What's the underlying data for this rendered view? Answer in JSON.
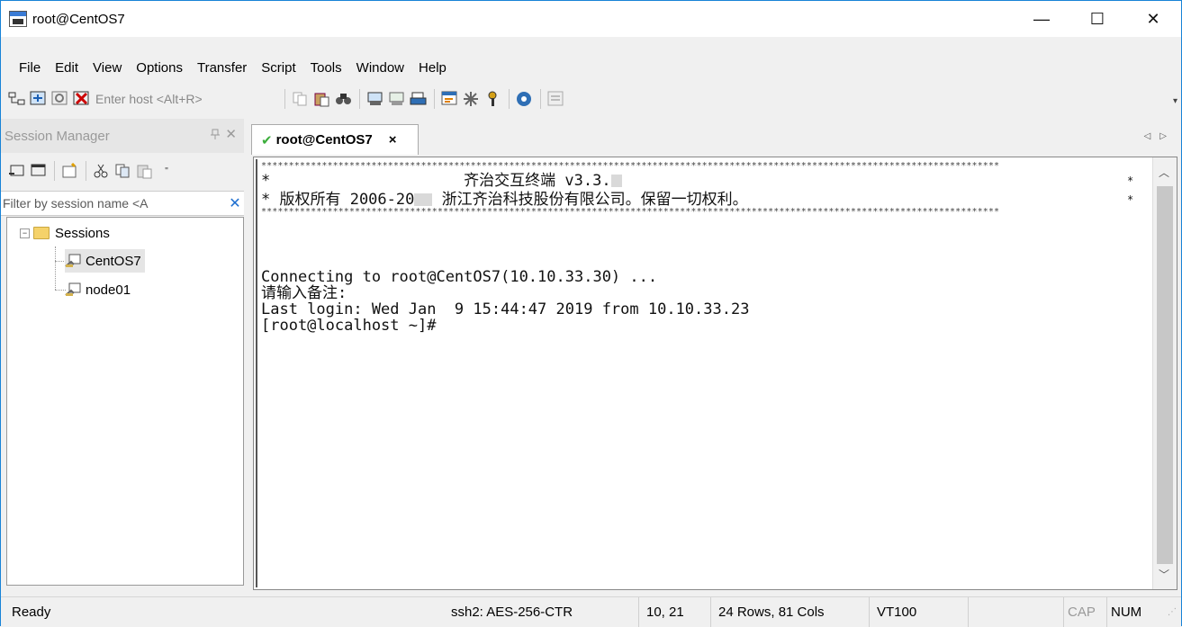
{
  "window": {
    "title": "root@CentOS7",
    "minimize": "—",
    "maximize": "☐",
    "close": "✕"
  },
  "menu": [
    "File",
    "Edit",
    "View",
    "Options",
    "Transfer",
    "Script",
    "Tools",
    "Window",
    "Help"
  ],
  "toolbar": {
    "host_placeholder": "Enter host <Alt+R>"
  },
  "session_manager": {
    "title": "Session Manager",
    "pin": "ᵖ",
    "close": "✕",
    "filter_placeholder": "Filter by session name <A",
    "tree": {
      "root": "Sessions",
      "items": [
        "CentOS7",
        "node01"
      ]
    }
  },
  "tabs": [
    {
      "label": "root@CentOS7",
      "close": "×"
    }
  ],
  "terminal": {
    "banner_stars": "**************************************************************************************************************************************",
    "banner_line1": "*                     齐治交互终端 v3.3.",
    "banner_line2": "* 版权所有 2006-20",
    "banner_line2b": " 浙江齐治科技股份有限公司。保留一切权利。",
    "lines": [
      "Connecting to root@CentOS7(10.10.33.30) ...",
      "请输入备注:",
      "Last login: Wed Jan  9 15:44:47 2019 from 10.10.33.23",
      "[root@localhost ~]#"
    ]
  },
  "status": {
    "ready": "Ready",
    "cipher": "ssh2: AES-256-CTR",
    "cursor": "10,  21",
    "size": "24 Rows, 81 Cols",
    "emulation": "VT100",
    "cap": "CAP",
    "num": "NUM"
  },
  "colors": {
    "accent_border": "#1883d7",
    "tab_check": "#3cae3c",
    "filter_clear": "#1e6fd0"
  }
}
